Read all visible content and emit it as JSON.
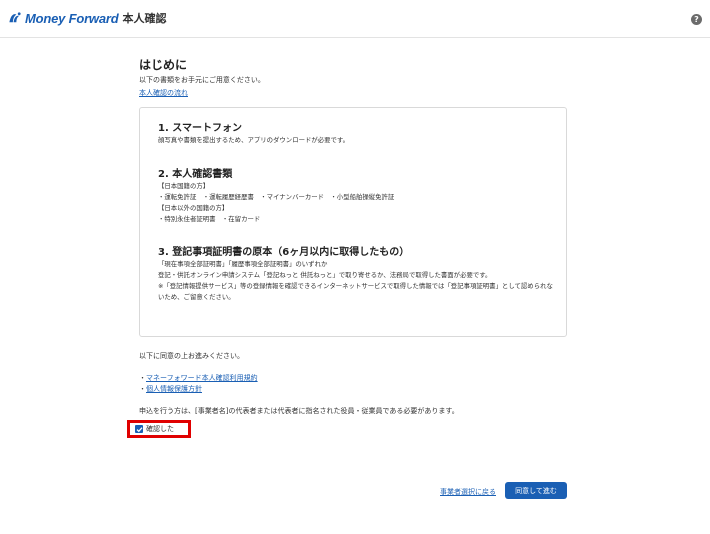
{
  "header": {
    "logo_text": "Money Forward",
    "app_name": "本人確認",
    "help_icon": "?",
    "brand_color": "#1a5fb4"
  },
  "main": {
    "title": "はじめに",
    "intro": "以下の書類をお手元にご用意ください。",
    "flow_link": "本人確認の流れ",
    "sections": [
      {
        "title": "1. スマートフォン",
        "lines": [
          "顔写真や書類を提出するため、アプリのダウンロードが必要です。"
        ]
      },
      {
        "title": "2. 本人確認書類",
        "lines": [
          "【日本国籍の方】",
          "・運転免許証　・運転履歴経歴書　・マイナンバーカード　・小型船舶操縦免許証",
          "【日本以外の国籍の方】",
          "・特別永住者証明書　・在留カード"
        ]
      },
      {
        "title": "3. 登記事項証明書の原本（6ヶ月以内に取得したもの）",
        "lines": [
          "「現在事項全部証明書」「履歴事項全部証明書」のいずれか",
          "登記・供託オンライン申請システム「登記ねっと 供託ねっと」で取り寄せるか、法務局で取得した書面が必要です。",
          "※「登記情報提供サービス」等の登録情報を確認できるインターネットサービスで取得した情報では「登記事項証明書」として認められないため、ご留意ください。"
        ]
      }
    ],
    "agree_lead": "以下に同意の上お進みください。",
    "terms": [
      {
        "prefix": "・",
        "link": "マネーフォワード本人確認利用規約"
      },
      {
        "prefix": "・",
        "link": "個人情報保護方針"
      }
    ],
    "notice": "申込を行う方は、[事業者名]の代表者または代表者に指名された役員・従業員である必要があります。",
    "checkbox_label": "確認した",
    "checkbox_checked": true
  },
  "footer": {
    "back_link": "事業者選択に戻る",
    "next_button": "同意して進む"
  }
}
